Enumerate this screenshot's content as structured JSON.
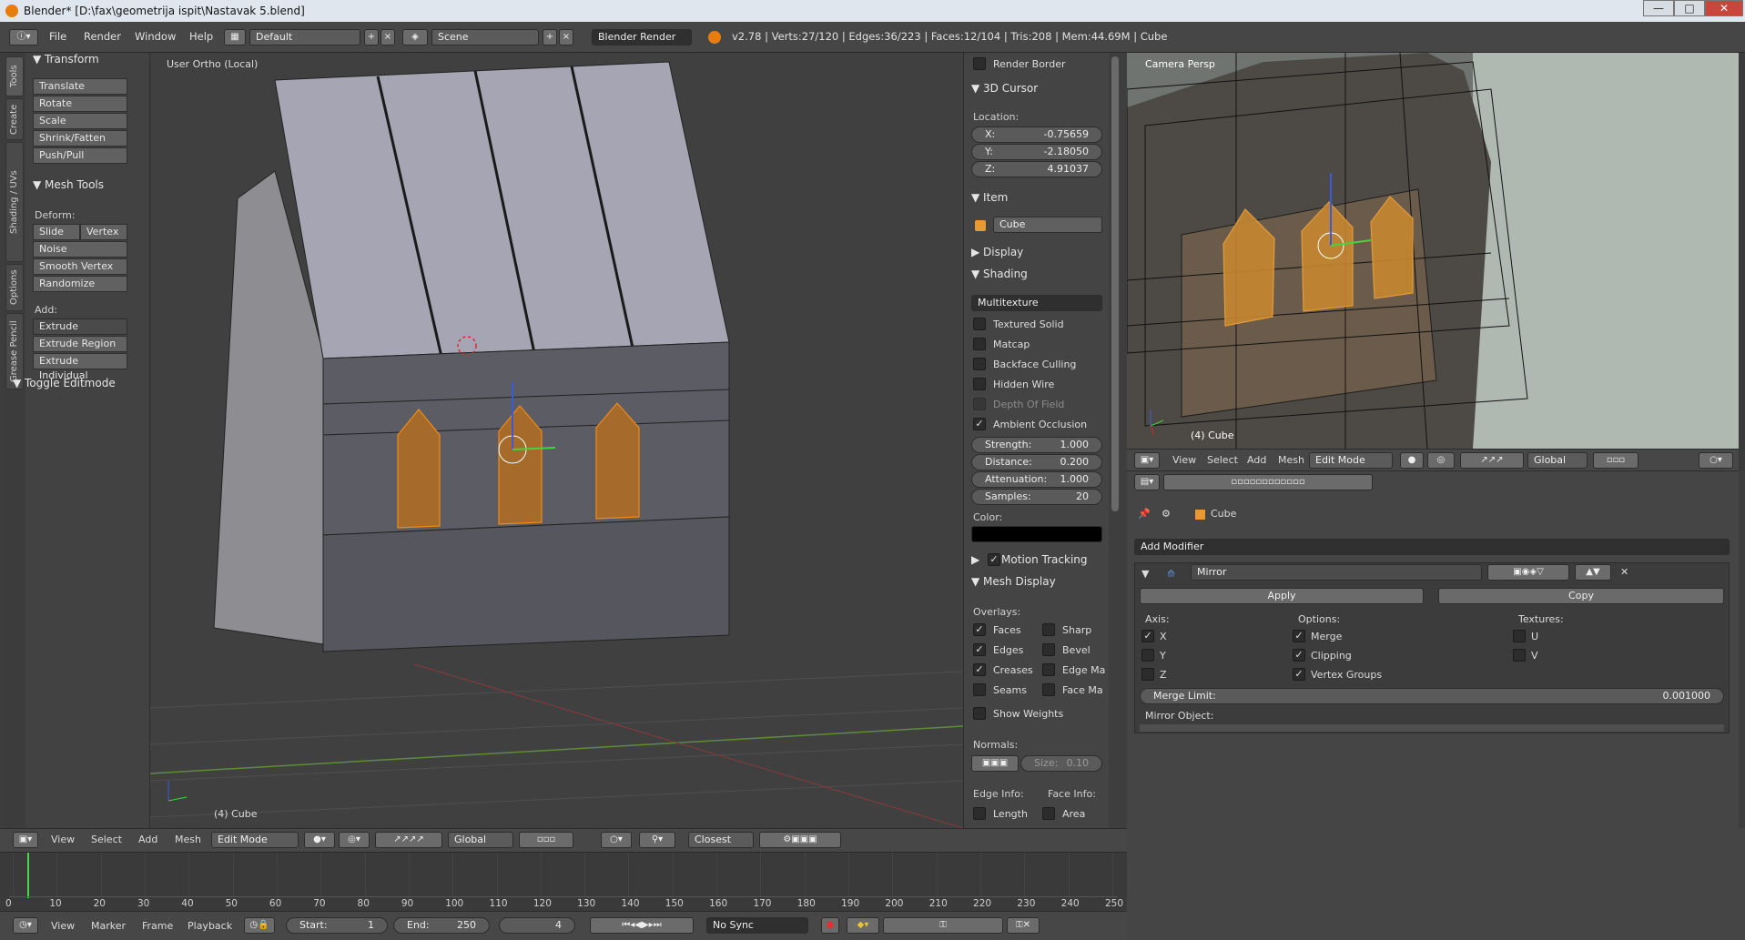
{
  "window": {
    "title": "Blender* [D:\\fax\\geometrija ispit\\Nastavak 5.blend]",
    "btn_min": "—",
    "btn_max": "□",
    "btn_close": "✕"
  },
  "menubar": {
    "menus": [
      "File",
      "Render",
      "Window",
      "Help"
    ],
    "layout": "Default",
    "scene": "Scene",
    "engine": "Blender Render",
    "stats": "v2.78 | Verts:27/120 | Edges:36/223 | Faces:12/104 | Tris:208 | Mem:44.69M | Cube"
  },
  "tabs": [
    "Tools",
    "Create",
    "Shading / UVs",
    "Options",
    "Grease Pencil"
  ],
  "tools": {
    "transform_title": "Transform",
    "transform": [
      "Translate",
      "Rotate",
      "Scale",
      "Shrink/Fatten",
      "Push/Pull"
    ],
    "mesh_tools_title": "Mesh Tools",
    "deform_label": "Deform:",
    "slide_edge": "Slide Ed",
    "vertex": "Vertex",
    "deform": [
      "Noise",
      "Smooth Vertex",
      "Randomize"
    ],
    "add_label": "Add:",
    "extrude": "Extrude",
    "add": [
      "Extrude Region",
      "Extrude Individual"
    ],
    "toggle": "Toggle Editmode"
  },
  "viewport": {
    "label": "User Ortho (Local)",
    "object": "(4) Cube"
  },
  "props": {
    "render_border": "Render Border",
    "cursor_title": "3D Cursor",
    "location": "Location:",
    "x_k": "X:",
    "x": "-0.75659",
    "y_k": "Y:",
    "y": "-2.18050",
    "z_k": "Z:",
    "z": "4.91037",
    "item_title": "Item",
    "item_name": "Cube",
    "display": "Display",
    "shading": "Shading",
    "shade_mode": "Multitexture",
    "shade_opts": [
      "Textured Solid",
      "Matcap",
      "Backface Culling",
      "Hidden Wire",
      "Depth Of Field"
    ],
    "ao": "Ambient Occlusion",
    "strength_k": "Strength:",
    "strength": "1.000",
    "distance_k": "Distance:",
    "distance": "0.200",
    "attenuation_k": "Attenuation:",
    "attenuation": "1.000",
    "samples_k": "Samples:",
    "samples": "20",
    "color": "Color:",
    "motion": "Motion Tracking",
    "mesh_display": "Mesh Display",
    "overlays": "Overlays:",
    "ov_left": [
      "Faces",
      "Edges",
      "Creases",
      "Seams"
    ],
    "ov_right": [
      "Sharp",
      "Bevel",
      "Edge Ma",
      "Face Ma"
    ],
    "show_weights": "Show Weights",
    "normals": "Normals:",
    "size": "Size:",
    "size_v": "0.10",
    "edge_info": "Edge Info:",
    "face_info": "Face Info:",
    "length": "Length",
    "area": "Area"
  },
  "camera": {
    "label": "Camera Persp",
    "object": "(4) Cube"
  },
  "camheader": {
    "menus": [
      "View",
      "Select",
      "Add",
      "Mesh"
    ],
    "mode": "Edit Mode",
    "orient": "Global"
  },
  "modifier": {
    "breadcrumb": "Cube",
    "add": "Add Modifier",
    "name": "Mirror",
    "apply": "Apply",
    "copy": "Copy",
    "axis": "Axis:",
    "axes": [
      "X",
      "Y",
      "Z"
    ],
    "options": "Options:",
    "opts": [
      "Merge",
      "Clipping",
      "Vertex Groups"
    ],
    "textures": "Textures:",
    "tex": [
      "U",
      "V"
    ],
    "merge_limit_k": "Merge Limit:",
    "merge_limit": "0.001000",
    "mirror_object": "Mirror Object:"
  },
  "vpheader": {
    "menus": [
      "View",
      "Select",
      "Add",
      "Mesh"
    ],
    "mode": "Edit Mode",
    "orient": "Global",
    "snap": "Closest"
  },
  "timeline": {
    "ticks": [
      "0",
      "10",
      "20",
      "30",
      "40",
      "50",
      "60",
      "70",
      "80",
      "90",
      "100",
      "110",
      "120",
      "130",
      "140",
      "150",
      "160",
      "170",
      "180",
      "190",
      "200",
      "210",
      "220",
      "230",
      "240",
      "250"
    ]
  },
  "tlheader": {
    "menus": [
      "View",
      "Marker",
      "Frame",
      "Playback"
    ],
    "start_k": "Start:",
    "start": "1",
    "end_k": "End:",
    "end": "250",
    "frame": "4",
    "sync": "No Sync"
  }
}
